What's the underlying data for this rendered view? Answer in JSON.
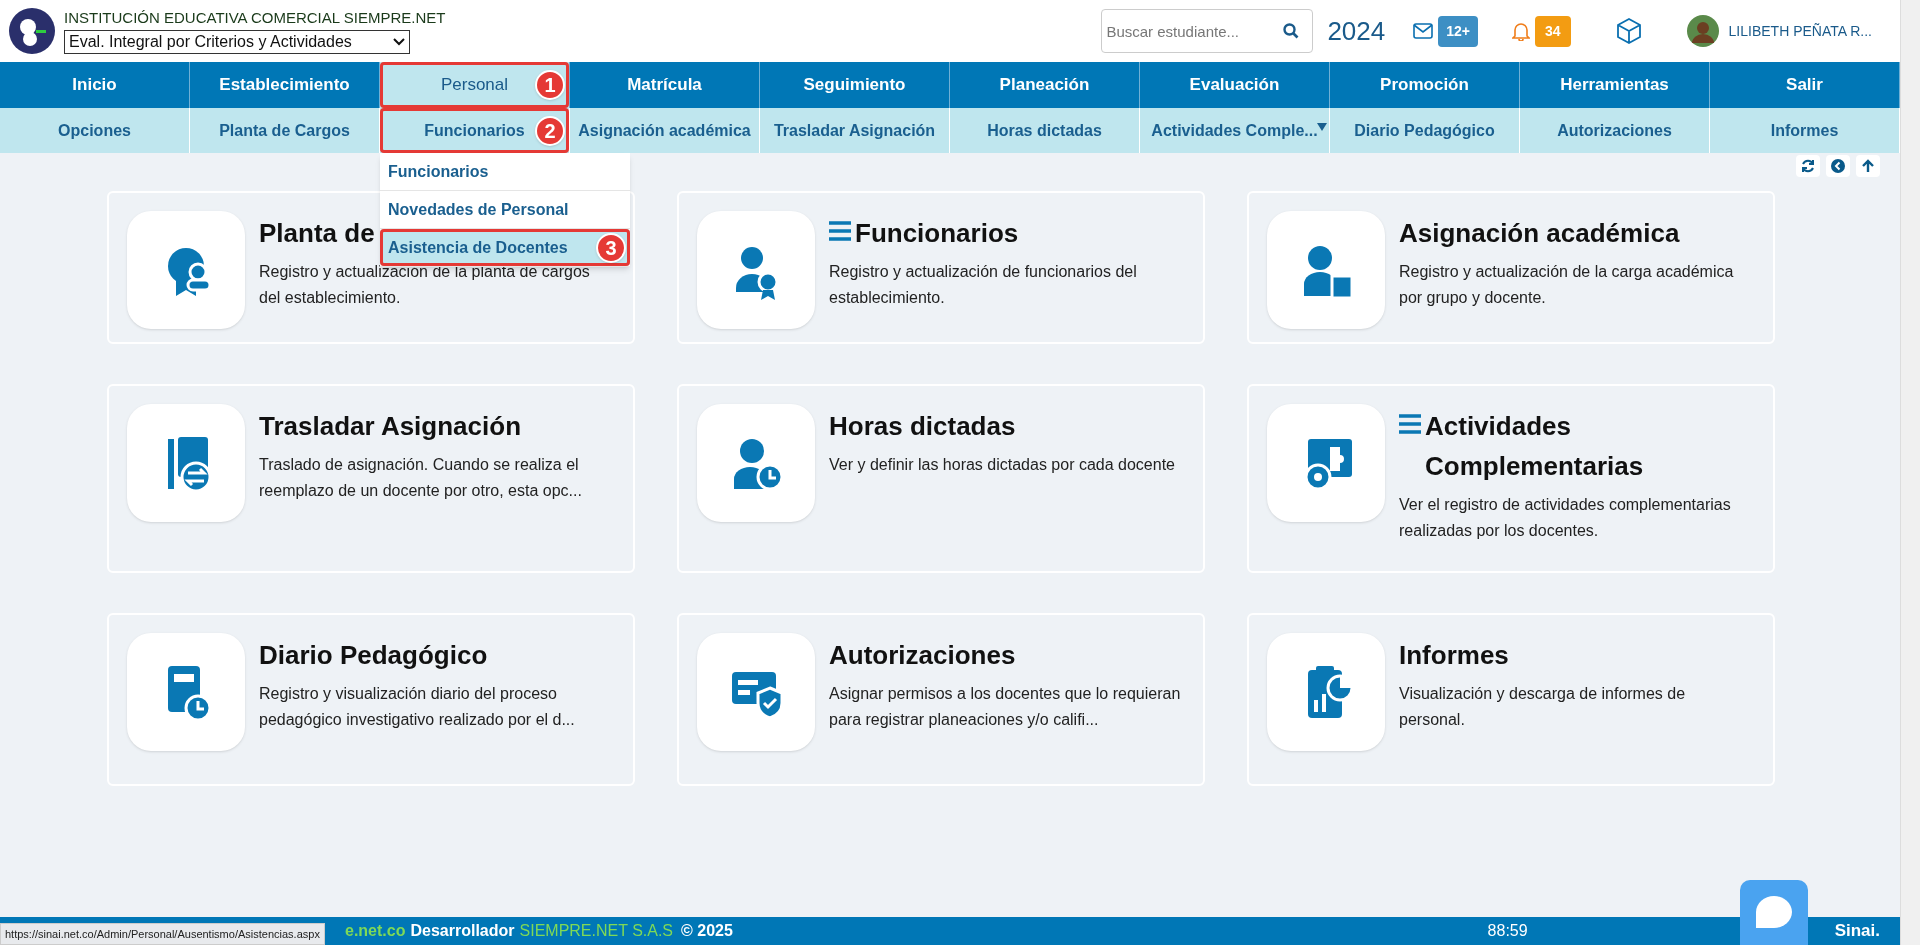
{
  "header": {
    "institution": "INSTITUCIÓN EDUCATIVA COMERCIAL SIEMPRE.NET",
    "evaluation_select": "Eval. Integral por Criterios y Actividades",
    "search": {
      "placeholder": "Buscar estudiante..."
    },
    "year": "2024",
    "messages_badge": "12+",
    "notifications_badge": "34",
    "user_name": "LILIBETH PEÑATA R..."
  },
  "main_menu": [
    {
      "label": "Inicio",
      "selected": false
    },
    {
      "label": "Establecimiento",
      "selected": false
    },
    {
      "label": "Personal",
      "selected": true,
      "callout": "1"
    },
    {
      "label": "Matrícula",
      "selected": false
    },
    {
      "label": "Seguimiento",
      "selected": false
    },
    {
      "label": "Planeación",
      "selected": false
    },
    {
      "label": "Evaluación",
      "selected": false
    },
    {
      "label": "Promoción",
      "selected": false
    },
    {
      "label": "Herramientas",
      "selected": false
    },
    {
      "label": "Salir",
      "selected": false
    }
  ],
  "sub_menu": [
    {
      "label": "Opciones",
      "has_dropdown": false
    },
    {
      "label": "Planta de Cargos",
      "has_dropdown": false
    },
    {
      "label": "Funcionarios",
      "has_dropdown": false,
      "callout": "2"
    },
    {
      "label": "Asignación académica",
      "has_dropdown": false
    },
    {
      "label": "Trasladar Asignación",
      "has_dropdown": false
    },
    {
      "label": "Horas dictadas",
      "has_dropdown": false
    },
    {
      "label": "Actividades Comple...",
      "has_dropdown": true
    },
    {
      "label": "Diario Pedagógico",
      "has_dropdown": false
    },
    {
      "label": "Autorizaciones",
      "has_dropdown": false
    },
    {
      "label": "Informes",
      "has_dropdown": false
    }
  ],
  "dropdown": [
    {
      "label": "Funcionarios",
      "highlighted": false
    },
    {
      "label": "Novedades de Personal",
      "highlighted": false
    },
    {
      "label": "Asistencia de Docentes",
      "highlighted": true,
      "callout": "3"
    }
  ],
  "cards": [
    {
      "kind": "award",
      "title": "Planta de",
      "has_menu": false,
      "description": "Registro y actualización de la planta de cargos del establecimiento."
    },
    {
      "kind": "staff",
      "title": "Funcionarios",
      "has_menu": true,
      "description": "Registro y actualización de funcionarios del establecimiento."
    },
    {
      "kind": "assign",
      "title": "Asignación académica",
      "has_menu": false,
      "description": "Registro y actualización de la carga académica por grupo y docente."
    },
    {
      "kind": "transfer",
      "title": "Trasladar Asignación",
      "has_menu": false,
      "description": "Traslado de asignación. Cuando se realiza el reemplazo de un docente por otro, esta opc..."
    },
    {
      "kind": "hours",
      "title": "Horas dictadas",
      "has_menu": false,
      "description": "Ver y definir las horas dictadas por cada docente"
    },
    {
      "kind": "puzzle",
      "title": "Actividades Complementarias",
      "has_menu": true,
      "description": "Ver el registro de actividades complementarias realizadas por los docentes."
    },
    {
      "kind": "diary",
      "title": "Diario Pedagógico",
      "has_menu": false,
      "description": "Registro y visualización diario del proceso pedagógico investigativo realizado por el d..."
    },
    {
      "kind": "shield",
      "title": "Autorizaciones",
      "has_menu": false,
      "description": "Asignar permisos a los docentes que lo requieran para registrar planeaciones y/o califi..."
    },
    {
      "kind": "report",
      "title": "Informes",
      "has_menu": false,
      "description": "Visualización y descarga de informes de personal."
    }
  ],
  "footer": {
    "site": "e.net.co",
    "developer_label": "Desarrollador",
    "developer": "SIEMPRE.NET S.A.S",
    "copyright": "© 2025",
    "timer": "88:59",
    "logo": "Sinai."
  },
  "status_url": "https://sinai.net.co/Admin/Personal/Ausentismo/Asistencias.aspx"
}
